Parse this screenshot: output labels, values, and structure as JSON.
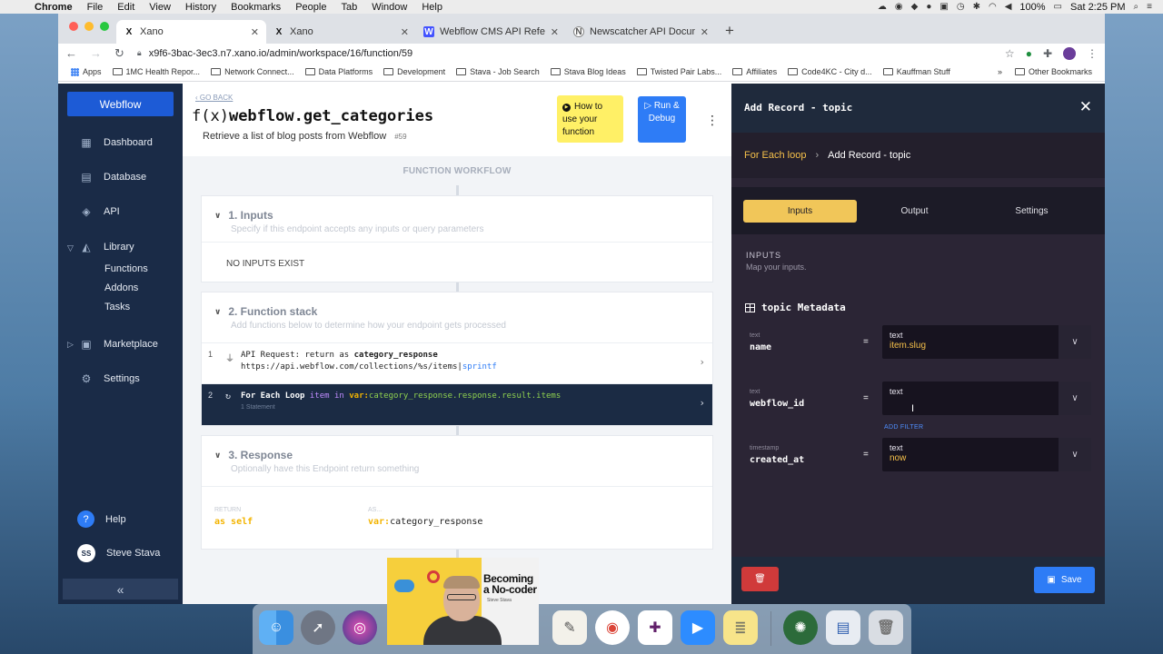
{
  "menubar": {
    "app": "Chrome",
    "items": [
      "File",
      "Edit",
      "View",
      "History",
      "Bookmarks",
      "People",
      "Tab",
      "Window",
      "Help"
    ],
    "battery": "100%",
    "clock": "Sat 2:25 PM"
  },
  "browser": {
    "tabs": [
      {
        "title": "Xano",
        "icon": "X"
      },
      {
        "title": "Xano",
        "icon": "X"
      },
      {
        "title": "Webflow CMS API Reference",
        "icon": "W"
      },
      {
        "title": "Newscatcher API Documentati",
        "icon": "N"
      }
    ],
    "url": "x9f6-3bac-3ec3.n7.xano.io/admin/workspace/16/function/59",
    "bookmarks": [
      "Apps",
      "1MC Health Repor...",
      "Network Connect...",
      "Data Platforms",
      "Development",
      "Stava - Job Search",
      "Stava Blog Ideas",
      "Twisted Pair Labs...",
      "Affiliates",
      "Code4KC - City d...",
      "Kauffman Stuff"
    ],
    "bookmarks_more": "»",
    "other_bookmarks": "Other Bookmarks"
  },
  "sidebar": {
    "brand": "Webflow",
    "items": [
      {
        "label": "Dashboard",
        "icon": "dashboard-icon"
      },
      {
        "label": "Database",
        "icon": "database-icon"
      },
      {
        "label": "API",
        "icon": "api-icon"
      },
      {
        "label": "Library",
        "icon": "library-icon"
      },
      {
        "label": "Marketplace",
        "icon": "marketplace-icon"
      },
      {
        "label": "Settings",
        "icon": "gear-icon"
      }
    ],
    "library_sub": [
      "Functions",
      "Addons",
      "Tasks"
    ],
    "help": "Help",
    "user": {
      "initials": "SS",
      "name": "Steve Stava"
    },
    "collapse": "«"
  },
  "function": {
    "goback": "GO BACK",
    "title": "webflow.get_categories",
    "fx": "f(x)",
    "description": "Retrieve a list of blog posts from Webflow",
    "id": "#59",
    "howto": "How to use your function",
    "run": "Run & Debug",
    "workflow_label": "FUNCTION WORKFLOW",
    "inputs": {
      "title": "1. Inputs",
      "subtitle": "Specify if this endpoint accepts any inputs or query parameters",
      "empty": "NO INPUTS EXIST"
    },
    "stack": {
      "title": "2. Function stack",
      "subtitle": "Add functions below to determine how your endpoint gets processed",
      "rows": [
        {
          "num": "1",
          "line1_prefix": "API Request: return as ",
          "line1_var": "category_response",
          "line2_url": "https://api.webflow.com/collections/%s/items|",
          "line2_filter": "sprintf"
        },
        {
          "num": "2",
          "line1_prefix": "For Each Loop ",
          "line1_item": "item",
          "line1_in": " in ",
          "line1_var": "var:",
          "line1_path": "category_response.response.result.items",
          "line2": "1 Statement"
        }
      ]
    },
    "response": {
      "title": "3. Response",
      "subtitle": "Optionally have this Endpoint return something",
      "return_label": "RETURN",
      "return_value": "as self",
      "as_label": "AS...",
      "as_var": "var:",
      "as_value": "category_response"
    }
  },
  "panel": {
    "title": "Add Record - topic",
    "breadcrumb": [
      "For Each loop",
      "Add Record - topic"
    ],
    "tabs": [
      "Inputs",
      "Output",
      "Settings"
    ],
    "inputs_heading": "INPUTS",
    "inputs_sub": "Map your inputs.",
    "meta_title": "topic Metadata",
    "fields": [
      {
        "type": "text",
        "name": "name",
        "value_type": "text",
        "value": "item.slug"
      },
      {
        "type": "text",
        "name": "webflow_id",
        "value_type": "text",
        "value": ""
      },
      {
        "type": "timestamp",
        "name": "created_at",
        "value_type": "text",
        "value": "now"
      }
    ],
    "add_filter": "ADD FILTER",
    "save": "Save"
  },
  "webcam": {
    "book_title_1": "Becoming",
    "book_title_2": "a No-coder",
    "book_sub": "Steve Stava"
  },
  "colors": {
    "sidebar": "#1a2b47",
    "brand_blue": "#2e7cf6",
    "panel_bg": "#2b2535",
    "accent_yellow": "#f1c659",
    "delete_red": "#d03a3a"
  }
}
